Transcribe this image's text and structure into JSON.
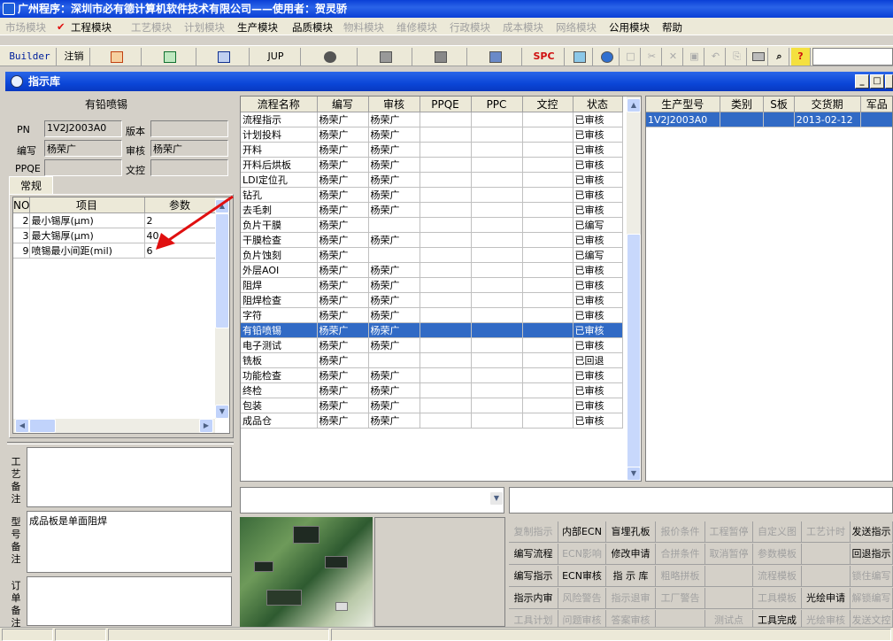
{
  "app_title": "广州程序：深圳市必有德计算机软件技术有限公司——使用者：贺灵骄",
  "menu": [
    {
      "label": "市场模块",
      "enabled": false
    },
    {
      "label": "工程模块",
      "enabled": true
    },
    {
      "label": "工艺模块",
      "enabled": false
    },
    {
      "label": "计划模块",
      "enabled": false
    },
    {
      "label": "生产模块",
      "enabled": true
    },
    {
      "label": "品质模块",
      "enabled": true
    },
    {
      "label": "物料模块",
      "enabled": false
    },
    {
      "label": "维修模块",
      "enabled": false
    },
    {
      "label": "行政模块",
      "enabled": false
    },
    {
      "label": "成本模块",
      "enabled": false
    },
    {
      "label": "网络模块",
      "enabled": false
    },
    {
      "label": "公用模块",
      "enabled": true
    },
    {
      "label": "帮助",
      "enabled": true
    }
  ],
  "toolbar": {
    "builder": "Builder",
    "logout": "注销",
    "jup": "JUP",
    "spc": "SPC"
  },
  "window_title": "指示库",
  "left": {
    "heading": "有铅喷锡",
    "pn_label": "PN",
    "pn_value": "1V2J2003A0",
    "version_label": "版本",
    "version_value": "",
    "editor_label": "编写",
    "editor_value": "杨荣广",
    "reviewer_label": "审核",
    "reviewer_value": "杨荣广",
    "ppqe_label": "PPQE",
    "ppqe_value": "",
    "doc_label": "文控",
    "doc_value": "",
    "tab": "常规",
    "param_headers": [
      "NO",
      "项目",
      "参数"
    ],
    "params": [
      {
        "no": "2",
        "item": "最小锡厚(μm)",
        "value": "2"
      },
      {
        "no": "3",
        "item": "最大锡厚(μm)",
        "value": "40"
      },
      {
        "no": "9",
        "item": "喷锡最小间距(mil)",
        "value": "6"
      }
    ],
    "memo1_label": "工艺备注",
    "memo1_value": "",
    "memo2_label": "型号备注",
    "memo2_value": "成品板是单面阻焊",
    "memo3_label": "订单备注",
    "memo3_value": ""
  },
  "process_table": {
    "headers": [
      "流程名称",
      "编写",
      "审核",
      "PPQE",
      "PPC",
      "文控",
      "状态"
    ],
    "rows": [
      [
        "流程指示",
        "杨荣广",
        "杨荣广",
        "",
        "",
        "",
        "已审核"
      ],
      [
        "计划投料",
        "杨荣广",
        "杨荣广",
        "",
        "",
        "",
        "已审核"
      ],
      [
        "开料",
        "杨荣广",
        "杨荣广",
        "",
        "",
        "",
        "已审核"
      ],
      [
        "开料后烘板",
        "杨荣广",
        "杨荣广",
        "",
        "",
        "",
        "已审核"
      ],
      [
        "LDI定位孔",
        "杨荣广",
        "杨荣广",
        "",
        "",
        "",
        "已审核"
      ],
      [
        "钻孔",
        "杨荣广",
        "杨荣广",
        "",
        "",
        "",
        "已审核"
      ],
      [
        "去毛刺",
        "杨荣广",
        "杨荣广",
        "",
        "",
        "",
        "已审核"
      ],
      [
        "负片干膜",
        "杨荣广",
        "",
        "",
        "",
        "",
        "已编写"
      ],
      [
        "干膜检查",
        "杨荣广",
        "杨荣广",
        "",
        "",
        "",
        "已审核"
      ],
      [
        "负片蚀刻",
        "杨荣广",
        "",
        "",
        "",
        "",
        "已编写"
      ],
      [
        "外层AOI",
        "杨荣广",
        "杨荣广",
        "",
        "",
        "",
        "已审核"
      ],
      [
        "阻焊",
        "杨荣广",
        "杨荣广",
        "",
        "",
        "",
        "已审核"
      ],
      [
        "阻焊检查",
        "杨荣广",
        "杨荣广",
        "",
        "",
        "",
        "已审核"
      ],
      [
        "字符",
        "杨荣广",
        "杨荣广",
        "",
        "",
        "",
        "已审核"
      ],
      [
        "有铅喷锡",
        "杨荣广",
        "杨荣广",
        "",
        "",
        "",
        "已审核"
      ],
      [
        "电子测试",
        "杨荣广",
        "杨荣广",
        "",
        "",
        "",
        "已审核"
      ],
      [
        "铣板",
        "杨荣广",
        "",
        "",
        "",
        "",
        "已回退"
      ],
      [
        "功能检查",
        "杨荣广",
        "杨荣广",
        "",
        "",
        "",
        "已审核"
      ],
      [
        "终检",
        "杨荣广",
        "杨荣广",
        "",
        "",
        "",
        "已审核"
      ],
      [
        "包装",
        "杨荣广",
        "杨荣广",
        "",
        "",
        "",
        "已审核"
      ],
      [
        "成品仓",
        "杨荣广",
        "杨荣广",
        "",
        "",
        "",
        "已审核"
      ]
    ],
    "selected_index": 14
  },
  "model_table": {
    "headers": [
      "生产型号",
      "类别",
      "S板",
      "交货期",
      "军品"
    ],
    "rows": [
      [
        "1V2J2003A0",
        "",
        "",
        "2013-02-12",
        ""
      ]
    ]
  },
  "combo_left": "",
  "combo_right": "",
  "actions": [
    [
      {
        "label": "复制指示",
        "enabled": false
      },
      {
        "label": "内部ECN",
        "enabled": true
      },
      {
        "label": "盲埋孔板",
        "enabled": true
      },
      {
        "label": "报价条件",
        "enabled": false
      },
      {
        "label": "工程暂停",
        "enabled": false
      },
      {
        "label": "自定义图",
        "enabled": false
      },
      {
        "label": "工艺计时",
        "enabled": false
      },
      {
        "label": "发送指示",
        "enabled": true
      }
    ],
    [
      {
        "label": "编写流程",
        "enabled": true
      },
      {
        "label": "ECN影响",
        "enabled": false
      },
      {
        "label": "修改申请",
        "enabled": true
      },
      {
        "label": "合拼条件",
        "enabled": false
      },
      {
        "label": "取消暂停",
        "enabled": false
      },
      {
        "label": "参数模板",
        "enabled": false
      },
      {
        "label": "",
        "enabled": false
      },
      {
        "label": "回退指示",
        "enabled": true
      }
    ],
    [
      {
        "label": "编写指示",
        "enabled": true
      },
      {
        "label": "ECN审核",
        "enabled": true
      },
      {
        "label": "指 示 库",
        "enabled": true
      },
      {
        "label": "粗略拼板",
        "enabled": false
      },
      {
        "label": "",
        "enabled": false
      },
      {
        "label": "流程模板",
        "enabled": false
      },
      {
        "label": "",
        "enabled": false
      },
      {
        "label": "锁住编写",
        "enabled": false
      }
    ],
    [
      {
        "label": "指示内审",
        "enabled": true
      },
      {
        "label": "风险警告",
        "enabled": false
      },
      {
        "label": "指示退审",
        "enabled": false
      },
      {
        "label": "工厂警告",
        "enabled": false
      },
      {
        "label": "",
        "enabled": false
      },
      {
        "label": "工具模板",
        "enabled": false
      },
      {
        "label": "光绘申请",
        "enabled": true
      },
      {
        "label": "解锁编写",
        "enabled": false
      }
    ],
    [
      {
        "label": "工具计划",
        "enabled": false
      },
      {
        "label": "问题审核",
        "enabled": false
      },
      {
        "label": "答案审核",
        "enabled": false
      },
      {
        "label": "",
        "enabled": false
      },
      {
        "label": "测试点",
        "enabled": false
      },
      {
        "label": "工具完成",
        "enabled": true
      },
      {
        "label": "光绘审核",
        "enabled": false
      },
      {
        "label": "发送文控",
        "enabled": false
      }
    ]
  ]
}
